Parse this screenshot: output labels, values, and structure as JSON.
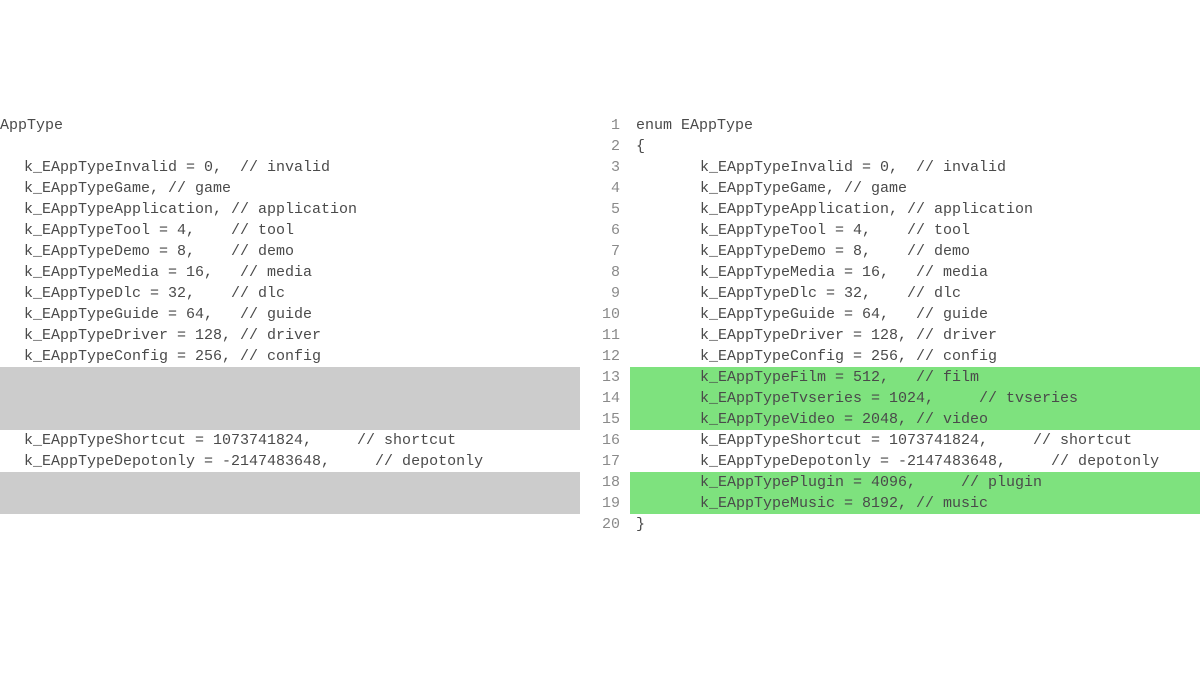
{
  "left": {
    "lines": [
      {
        "n": "",
        "text": "AppType",
        "bg": ""
      },
      {
        "n": "",
        "text": "",
        "bg": ""
      },
      {
        "n": "",
        "text": "k_EAppTypeInvalid = 0,  // invalid",
        "bg": ""
      },
      {
        "n": "",
        "text": "k_EAppTypeGame, // game",
        "bg": ""
      },
      {
        "n": "",
        "text": "k_EAppTypeApplication, // application",
        "bg": ""
      },
      {
        "n": "",
        "text": "k_EAppTypeTool = 4,    // tool",
        "bg": ""
      },
      {
        "n": "",
        "text": "k_EAppTypeDemo = 8,    // demo",
        "bg": ""
      },
      {
        "n": "",
        "text": "k_EAppTypeMedia = 16,   // media",
        "bg": ""
      },
      {
        "n": "",
        "text": "k_EAppTypeDlc = 32,    // dlc",
        "bg": ""
      },
      {
        "n": "",
        "text": "k_EAppTypeGuide = 64,   // guide",
        "bg": ""
      },
      {
        "n": "",
        "text": "k_EAppTypeDriver = 128, // driver",
        "bg": ""
      },
      {
        "n": "",
        "text": "k_EAppTypeConfig = 256, // config",
        "bg": ""
      },
      {
        "n": "",
        "text": "",
        "bg": "removed"
      },
      {
        "n": "",
        "text": "",
        "bg": "removed"
      },
      {
        "n": "",
        "text": "",
        "bg": "removed"
      },
      {
        "n": "",
        "text": "k_EAppTypeShortcut = 1073741824,     // shortcut",
        "bg": ""
      },
      {
        "n": "",
        "text": "k_EAppTypeDepotonly = -2147483648,     // depotonly",
        "bg": ""
      },
      {
        "n": "",
        "text": "",
        "bg": "removed"
      },
      {
        "n": "",
        "text": "",
        "bg": "removed"
      },
      {
        "n": "",
        "text": "",
        "bg": ""
      }
    ]
  },
  "right": {
    "lines": [
      {
        "n": "1",
        "text": "enum EAppType",
        "bg": "",
        "indent": false
      },
      {
        "n": "2",
        "text": "{",
        "bg": "",
        "indent": false
      },
      {
        "n": "3",
        "text": "k_EAppTypeInvalid = 0,  // invalid",
        "bg": "",
        "indent": true
      },
      {
        "n": "4",
        "text": "k_EAppTypeGame, // game",
        "bg": "",
        "indent": true
      },
      {
        "n": "5",
        "text": "k_EAppTypeApplication, // application",
        "bg": "",
        "indent": true
      },
      {
        "n": "6",
        "text": "k_EAppTypeTool = 4,    // tool",
        "bg": "",
        "indent": true
      },
      {
        "n": "7",
        "text": "k_EAppTypeDemo = 8,    // demo",
        "bg": "",
        "indent": true
      },
      {
        "n": "8",
        "text": "k_EAppTypeMedia = 16,   // media",
        "bg": "",
        "indent": true
      },
      {
        "n": "9",
        "text": "k_EAppTypeDlc = 32,    // dlc",
        "bg": "",
        "indent": true
      },
      {
        "n": "10",
        "text": "k_EAppTypeGuide = 64,   // guide",
        "bg": "",
        "indent": true
      },
      {
        "n": "11",
        "text": "k_EAppTypeDriver = 128, // driver",
        "bg": "",
        "indent": true
      },
      {
        "n": "12",
        "text": "k_EAppTypeConfig = 256, // config",
        "bg": "",
        "indent": true
      },
      {
        "n": "13",
        "text": "k_EAppTypeFilm = 512,   // film",
        "bg": "added",
        "indent": true
      },
      {
        "n": "14",
        "text": "k_EAppTypeTvseries = 1024,     // tvseries",
        "bg": "added",
        "indent": true
      },
      {
        "n": "15",
        "text": "k_EAppTypeVideo = 2048, // video",
        "bg": "added",
        "indent": true
      },
      {
        "n": "16",
        "text": "k_EAppTypeShortcut = 1073741824,     // shortcut",
        "bg": "",
        "indent": true
      },
      {
        "n": "17",
        "text": "k_EAppTypeDepotonly = -2147483648,     // depotonly",
        "bg": "",
        "indent": true
      },
      {
        "n": "18",
        "text": "k_EAppTypePlugin = 4096,     // plugin",
        "bg": "added",
        "indent": true
      },
      {
        "n": "19",
        "text": "k_EAppTypeMusic = 8192, // music",
        "bg": "added",
        "indent": true
      },
      {
        "n": "20",
        "text": "}",
        "bg": "",
        "indent": false
      }
    ]
  }
}
